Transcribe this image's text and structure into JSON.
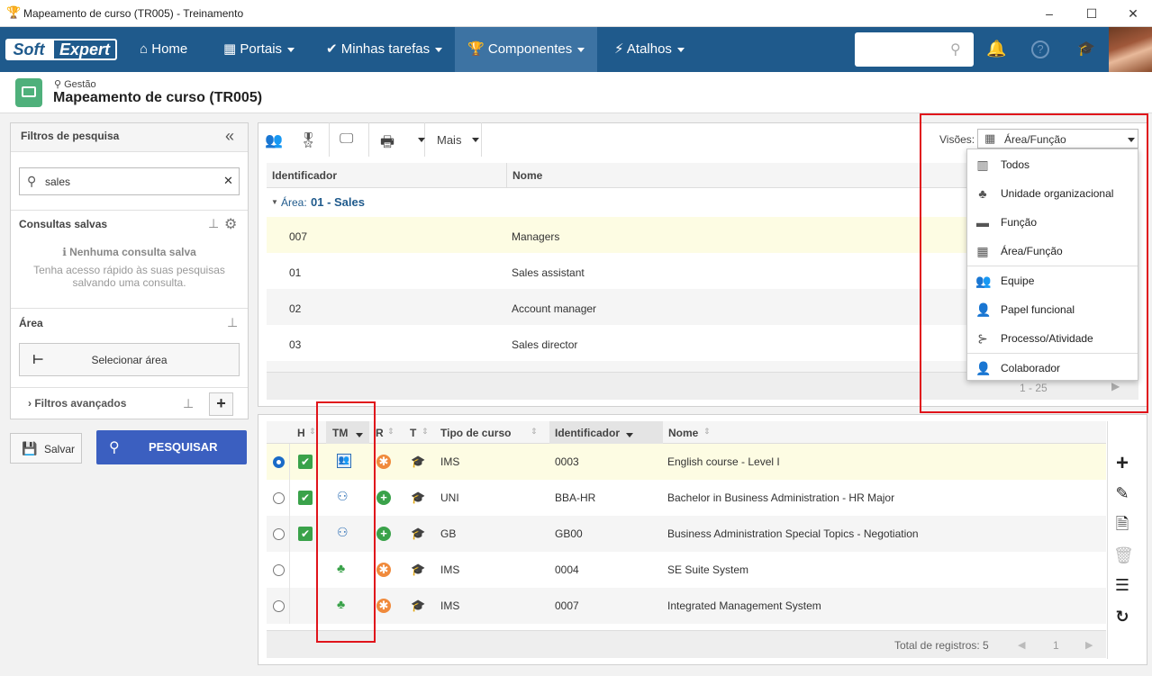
{
  "window": {
    "title": "Mapeamento de curso (TR005) - Treinamento",
    "min": "–",
    "max": "☐",
    "close": "✕"
  },
  "nav": {
    "logo_soft": "Soft",
    "logo_expert": "Expert",
    "items": [
      {
        "label": "Home"
      },
      {
        "label": "Portais"
      },
      {
        "label": "Minhas tarefas"
      },
      {
        "label": "Componentes"
      },
      {
        "label": "Atalhos"
      }
    ]
  },
  "header": {
    "breadcrumb": "Gestão",
    "title": "Mapeamento de curso (TR005)"
  },
  "filters": {
    "title": "Filtros de pesquisa",
    "collapse": "«",
    "search_value": "sales",
    "saved_title": "Consultas salvas",
    "no_saved": "Nenhuma consulta salva",
    "no_saved_hint_1": "Tenha acesso rápido às suas pesquisas",
    "no_saved_hint_2": "salvando uma consulta.",
    "area_title": "Área",
    "select_area": "Selecionar área",
    "advanced": "Filtros avançados",
    "save": "Salvar",
    "search": "PESQUISAR"
  },
  "toolbar": {
    "more": "Mais",
    "views_label": "Visões:",
    "views_value": "Área/Função"
  },
  "top_grid": {
    "col_id": "Identificador",
    "col_name": "Nome",
    "group_label": "Área:",
    "group_value": "01 - Sales",
    "rows": [
      {
        "id": "007",
        "name": "Managers"
      },
      {
        "id": "01",
        "name": "Sales assistant"
      },
      {
        "id": "02",
        "name": "Account manager"
      },
      {
        "id": "03",
        "name": "Sales director"
      }
    ],
    "pager": "1 - 25"
  },
  "views_menu": [
    {
      "label": "Todos",
      "icon": "building-icon"
    },
    {
      "label": "Unidade organizacional",
      "icon": "org-unit-icon"
    },
    {
      "label": "Função",
      "icon": "briefcase-icon"
    },
    {
      "label": "Área/Função",
      "icon": "grid-icon"
    },
    {
      "label": "Equipe",
      "icon": "team-icon"
    },
    {
      "label": "Papel funcional",
      "icon": "role-icon"
    },
    {
      "label": "Processo/Atividade",
      "icon": "process-icon"
    },
    {
      "label": "Colaborador",
      "icon": "person-icon"
    }
  ],
  "bottom_grid": {
    "cols": {
      "h": "H",
      "tm": "TM",
      "r": "R",
      "t": "T",
      "type": "Tipo de curso",
      "id": "Identificador",
      "name": "Nome"
    },
    "rows": [
      {
        "type": "IMS",
        "id": "0003",
        "name": "English course - Level I"
      },
      {
        "type": "UNI",
        "id": "BBA-HR",
        "name": "Bachelor in Business Administration - HR Major"
      },
      {
        "type": "GB",
        "id": "GB00",
        "name": "Business Administration Special Topics - Negotiation"
      },
      {
        "type": "IMS",
        "id": "0004",
        "name": "SE Suite System"
      },
      {
        "type": "IMS",
        "id": "0007",
        "name": "Integrated Management System"
      }
    ],
    "total": "Total de registros: 5",
    "page": "1"
  },
  "colors": {
    "nav": "#1f5a8c",
    "nav_active": "#3d73a3",
    "primary": "#3b5fc0",
    "highlight": "#fdfce3",
    "red_box": "#e0141b",
    "green": "#3aa24a",
    "orange": "#f08a3c"
  }
}
